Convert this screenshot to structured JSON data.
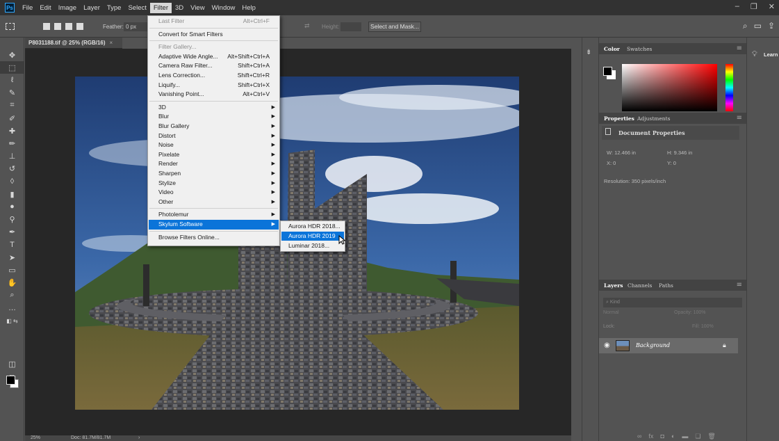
{
  "menubar": {
    "logo": "Ps",
    "items": [
      "File",
      "Edit",
      "Image",
      "Layer",
      "Type",
      "Select",
      "Filter",
      "3D",
      "View",
      "Window",
      "Help"
    ],
    "active_item": "Filter"
  },
  "options_bar": {
    "feather_label": "Feather:",
    "feather_value": "0 px",
    "height_label": "Height:",
    "select_and_mask": "Select and Mask..."
  },
  "document": {
    "tab_title": "P8031188.tif @ 25% (RGB/16)",
    "tab_close": "×",
    "zoom": "25%",
    "doc_size": "Doc: 81.7M/81.7M",
    "status_chevron": "›"
  },
  "filter_menu": {
    "items": [
      {
        "label": "Last Filter",
        "shortcut": "Alt+Ctrl+F",
        "disabled": true
      },
      {
        "sep": true
      },
      {
        "label": "Convert for Smart Filters"
      },
      {
        "sep": true
      },
      {
        "label": "Filter Gallery...",
        "disabled": true
      },
      {
        "label": "Adaptive Wide Angle...",
        "shortcut": "Alt+Shift+Ctrl+A"
      },
      {
        "label": "Camera Raw Filter...",
        "shortcut": "Shift+Ctrl+A"
      },
      {
        "label": "Lens Correction...",
        "shortcut": "Shift+Ctrl+R"
      },
      {
        "label": "Liquify...",
        "shortcut": "Shift+Ctrl+X"
      },
      {
        "label": "Vanishing Point...",
        "shortcut": "Alt+Ctrl+V"
      },
      {
        "sep": true
      },
      {
        "label": "3D",
        "submenu": true
      },
      {
        "label": "Blur",
        "submenu": true
      },
      {
        "label": "Blur Gallery",
        "submenu": true
      },
      {
        "label": "Distort",
        "submenu": true
      },
      {
        "label": "Noise",
        "submenu": true
      },
      {
        "label": "Pixelate",
        "submenu": true
      },
      {
        "label": "Render",
        "submenu": true
      },
      {
        "label": "Sharpen",
        "submenu": true
      },
      {
        "label": "Stylize",
        "submenu": true
      },
      {
        "label": "Video",
        "submenu": true
      },
      {
        "label": "Other",
        "submenu": true
      },
      {
        "sep": true
      },
      {
        "label": "Photolemur",
        "submenu": true
      },
      {
        "label": "Skylum Software",
        "submenu": true,
        "highlighted": true
      },
      {
        "sep": true
      },
      {
        "label": "Browse Filters Online..."
      }
    ]
  },
  "submenu": {
    "items": [
      {
        "label": "Aurora HDR 2018..."
      },
      {
        "label": "Aurora HDR 2019",
        "highlighted": true
      },
      {
        "label": "Luminar 2018..."
      }
    ]
  },
  "panels": {
    "color_tabs": [
      "Color",
      "Swatches"
    ],
    "properties_tabs": [
      "Properties",
      "Adjustments"
    ],
    "doc_properties_title": "Document Properties",
    "width": "W: 12.466 in",
    "height": "H: 9.346 in",
    "x": "X: 0",
    "y": "Y: 0",
    "resolution": "Resolution: 350 pixels/inch",
    "layers_tabs": [
      "Layers",
      "Channels",
      "Paths"
    ],
    "kind_placeholder": "Kind",
    "blend_mode": "Normal",
    "opacity": "Opacity: 100%",
    "lock_label": "Lock:",
    "fill": "Fill: 100%",
    "layer_name": "Background"
  },
  "learn": {
    "label": "Learn"
  },
  "colors": {
    "menu_highlight": "#0b74d9",
    "canvas_bg": "#272727",
    "panel_bg": "#535353",
    "menubar_bg": "#323232"
  }
}
